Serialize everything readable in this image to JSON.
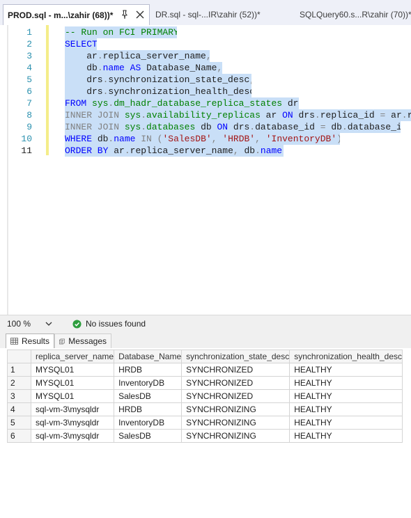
{
  "tabs": [
    {
      "label": "PROD.sql - m...\\zahir (68))*",
      "active": true
    },
    {
      "label": "DR.sql - sql-...IR\\zahir (52))*",
      "active": false
    },
    {
      "label": "SQLQuery60.s...R\\zahir (70))*",
      "active": false
    }
  ],
  "editor": {
    "line_numbers": [
      "1",
      "2",
      "3",
      "4",
      "5",
      "6",
      "7",
      "8",
      "9",
      "10",
      "11"
    ],
    "lines": [
      [
        {
          "t": "-- Run on FCI PRIMARY",
          "c": "cm"
        }
      ],
      [
        {
          "t": "SELECT",
          "c": "kw"
        }
      ],
      [
        {
          "t": "    ar",
          "c": "fn"
        },
        {
          "t": ".",
          "c": "gy"
        },
        {
          "t": "replica_server_name",
          "c": "fn"
        },
        {
          "t": ",",
          "c": "gy"
        }
      ],
      [
        {
          "t": "    db",
          "c": "fn"
        },
        {
          "t": ".",
          "c": "gy"
        },
        {
          "t": "name",
          "c": "kw"
        },
        {
          "t": " AS ",
          "c": "kw"
        },
        {
          "t": "Database_Name",
          "c": "fn"
        },
        {
          "t": ",",
          "c": "gy"
        }
      ],
      [
        {
          "t": "    drs",
          "c": "fn"
        },
        {
          "t": ".",
          "c": "gy"
        },
        {
          "t": "synchronization_state_desc",
          "c": "fn"
        },
        {
          "t": ",",
          "c": "gy"
        }
      ],
      [
        {
          "t": "    drs",
          "c": "fn"
        },
        {
          "t": ".",
          "c": "gy"
        },
        {
          "t": "synchronization_health_desc",
          "c": "fn"
        }
      ],
      [
        {
          "t": "FROM ",
          "c": "kw"
        },
        {
          "t": "sys",
          "c": "sys"
        },
        {
          "t": ".",
          "c": "gy"
        },
        {
          "t": "dm_hadr_database_replica_states",
          "c": "sys"
        },
        {
          "t": " drs",
          "c": "fn"
        }
      ],
      [
        {
          "t": "INNER JOIN ",
          "c": "kwg"
        },
        {
          "t": "sys",
          "c": "sys"
        },
        {
          "t": ".",
          "c": "gy"
        },
        {
          "t": "availability_replicas",
          "c": "sys"
        },
        {
          "t": " ar ",
          "c": "fn"
        },
        {
          "t": "ON ",
          "c": "kw"
        },
        {
          "t": "drs",
          "c": "fn"
        },
        {
          "t": ".",
          "c": "gy"
        },
        {
          "t": "replica_id ",
          "c": "fn"
        },
        {
          "t": "= ",
          "c": "gy"
        },
        {
          "t": "ar",
          "c": "fn"
        },
        {
          "t": ".",
          "c": "gy"
        },
        {
          "t": "replica_id",
          "c": "fn"
        }
      ],
      [
        {
          "t": "INNER JOIN ",
          "c": "kwg"
        },
        {
          "t": "sys",
          "c": "sys"
        },
        {
          "t": ".",
          "c": "gy"
        },
        {
          "t": "databases",
          "c": "sys"
        },
        {
          "t": " db ",
          "c": "fn"
        },
        {
          "t": "ON ",
          "c": "kw"
        },
        {
          "t": "drs",
          "c": "fn"
        },
        {
          "t": ".",
          "c": "gy"
        },
        {
          "t": "database_id ",
          "c": "fn"
        },
        {
          "t": "= ",
          "c": "gy"
        },
        {
          "t": "db",
          "c": "fn"
        },
        {
          "t": ".",
          "c": "gy"
        },
        {
          "t": "database_id",
          "c": "fn"
        }
      ],
      [
        {
          "t": "WHERE ",
          "c": "kw"
        },
        {
          "t": "db",
          "c": "fn"
        },
        {
          "t": ".",
          "c": "gy"
        },
        {
          "t": "name ",
          "c": "kw"
        },
        {
          "t": "IN ",
          "c": "gy"
        },
        {
          "t": "(",
          "c": "gy"
        },
        {
          "t": "'SalesDB'",
          "c": "st"
        },
        {
          "t": ", ",
          "c": "gy"
        },
        {
          "t": "'HRDB'",
          "c": "st"
        },
        {
          "t": ", ",
          "c": "gy"
        },
        {
          "t": "'InventoryDB'",
          "c": "st"
        },
        {
          "t": ")",
          "c": "gy"
        }
      ],
      [
        {
          "t": "ORDER BY ",
          "c": "kw"
        },
        {
          "t": "ar",
          "c": "fn"
        },
        {
          "t": ".",
          "c": "gy"
        },
        {
          "t": "replica_server_name",
          "c": "fn"
        },
        {
          "t": ", ",
          "c": "gy"
        },
        {
          "t": "db",
          "c": "fn"
        },
        {
          "t": ".",
          "c": "gy"
        },
        {
          "t": "name",
          "c": "kw"
        },
        {
          "t": ";",
          "c": "gy"
        }
      ]
    ]
  },
  "status": {
    "zoom": "100 %",
    "issues": "No issues found"
  },
  "result_tabs": {
    "results": "Results",
    "messages": "Messages"
  },
  "grid": {
    "columns": [
      "replica_server_name",
      "Database_Name",
      "synchronization_state_desc",
      "synchronization_health_desc"
    ],
    "rows": [
      [
        "1",
        "MYSQL01",
        "HRDB",
        "SYNCHRONIZED",
        "HEALTHY"
      ],
      [
        "2",
        "MYSQL01",
        "InventoryDB",
        "SYNCHRONIZED",
        "HEALTHY"
      ],
      [
        "3",
        "MYSQL01",
        "SalesDB",
        "SYNCHRONIZED",
        "HEALTHY"
      ],
      [
        "4",
        "sql-vm-3\\mysqldr",
        "HRDB",
        "SYNCHRONIZING",
        "HEALTHY"
      ],
      [
        "5",
        "sql-vm-3\\mysqldr",
        "InventoryDB",
        "SYNCHRONIZING",
        "HEALTHY"
      ],
      [
        "6",
        "sql-vm-3\\mysqldr",
        "SalesDB",
        "SYNCHRONIZING",
        "HEALTHY"
      ]
    ]
  },
  "colors": {
    "selection": "#c9dff7",
    "keyword": "#0000ff",
    "comment": "#008000",
    "string": "#a31515",
    "line_number": "#2b91af",
    "ok_icon": "#2e9e3e"
  },
  "icons": {
    "pin": "pin-icon",
    "close": "close-icon",
    "zoom_dropdown": "chevron-down-icon",
    "issues": "check-circle-icon",
    "results": "grid-icon",
    "messages": "messages-icon"
  }
}
